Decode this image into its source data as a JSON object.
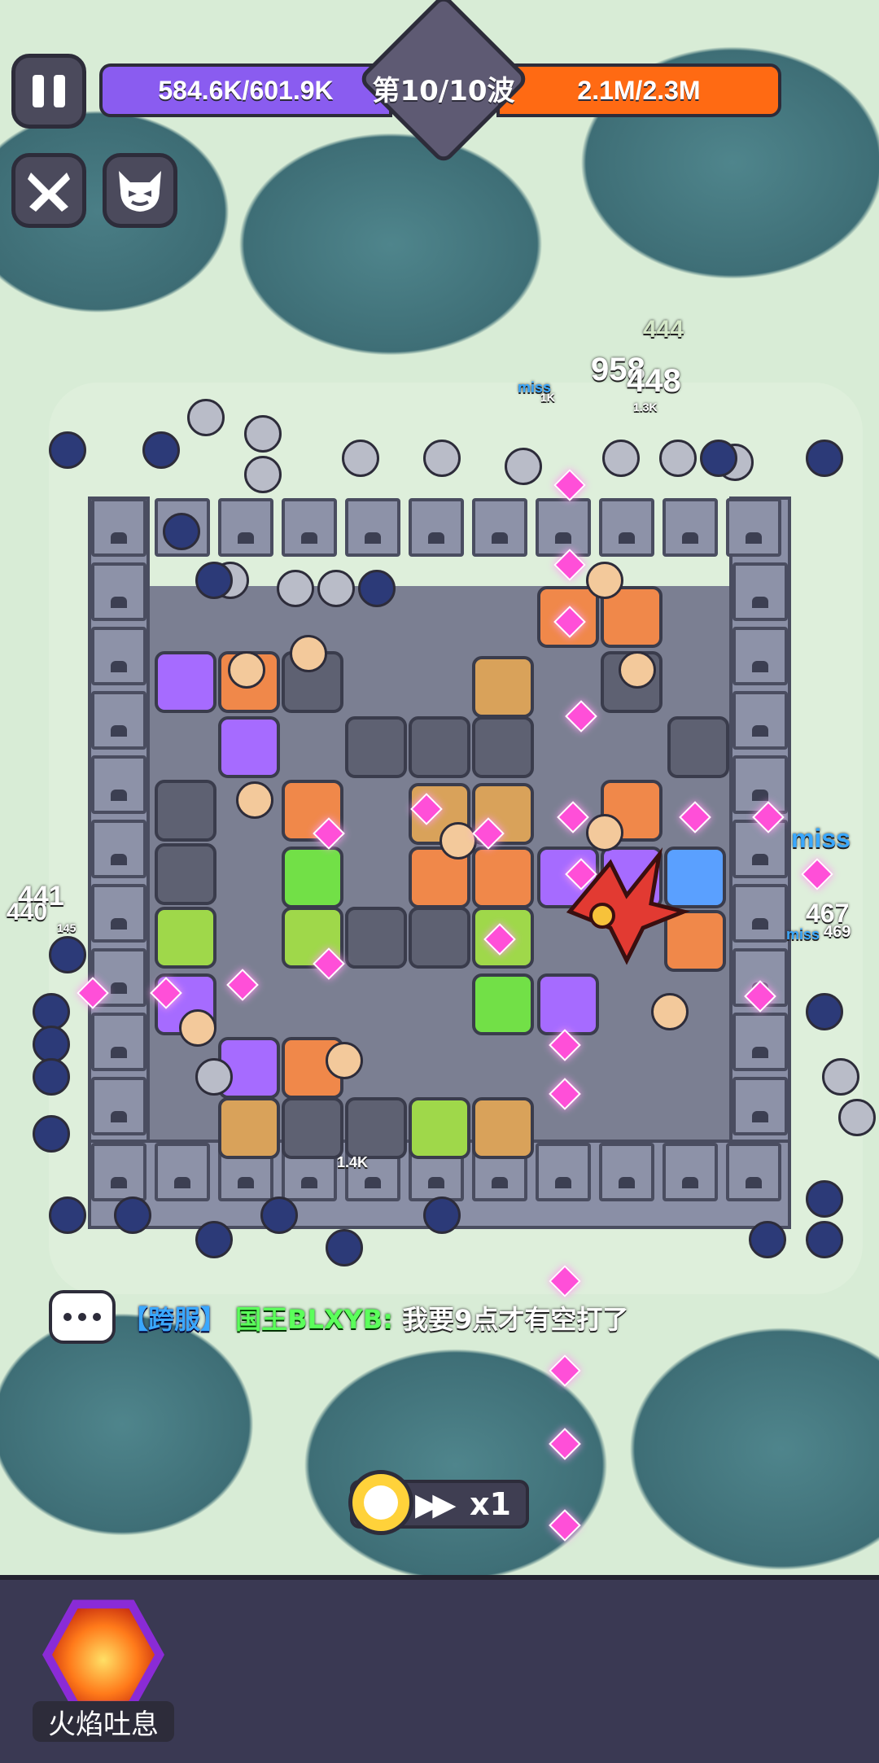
{
  "hud": {
    "player_hp": "584.6K/601.9K",
    "wave": "第10/10波",
    "enemy_hp": "2.1M/2.3M"
  },
  "floating_text": {
    "dmg_top_1": "444",
    "dmg_top_2": "958",
    "dmg_top_3": "448",
    "miss_top": "miss",
    "small_1k": "1K",
    "small_13k": "1.3K",
    "miss_right": "miss",
    "dmg_left_1": "441",
    "dmg_left_2": "440",
    "small_145": "145",
    "dmg_right_1": "467",
    "dmg_right_2": "469",
    "miss_right_2": "miss",
    "wall_14k": "1.4K"
  },
  "chat": {
    "channel": "【跨服】",
    "sender": "国王BLXYB:",
    "message": "我要9点才有空打了"
  },
  "speed": {
    "multiplier": "x1"
  },
  "skill": {
    "label": "火焰吐息"
  },
  "colors": {
    "hp_bar": "#8a5cf0",
    "enemy_bar": "#ff6a13",
    "chat_channel": "#3aa8ff",
    "chat_sender": "#5bff5b"
  }
}
